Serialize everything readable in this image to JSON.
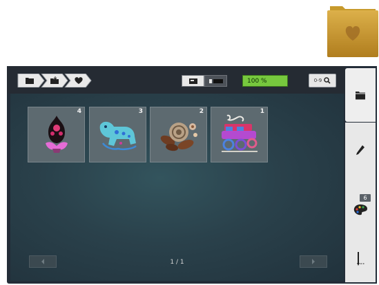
{
  "folder_preview": {
    "icon": "heart-folder-icon",
    "colors": {
      "folder": "#c89b2e",
      "heart": "#a8742a"
    }
  },
  "breadcrumb": [
    {
      "icon": "folder-icon"
    },
    {
      "icon": "open-folder-icon"
    },
    {
      "icon": "heart-icon"
    }
  ],
  "view_toggle": [
    {
      "icon": "embroidery-machine-icon",
      "active": true
    },
    {
      "icon": "list-view-icon",
      "active": false
    }
  ],
  "zoom_label": "100 %",
  "sort": {
    "label": "0-9",
    "icon": "magnifier-icon"
  },
  "designs": [
    {
      "number": "4",
      "motif": "paisley-flower"
    },
    {
      "number": "3",
      "motif": "blue-dog"
    },
    {
      "number": "2",
      "motif": "rose-leaves"
    },
    {
      "number": "1",
      "motif": "colorful-car"
    }
  ],
  "pagination": {
    "indicator": "1 / 1",
    "prev_icon": "arrow-left-icon",
    "next_icon": "arrow-right-icon"
  },
  "sidebar": [
    {
      "name": "folder",
      "icon": "folder-icon",
      "active": true
    },
    {
      "name": "edit",
      "icon": "pencil-icon"
    },
    {
      "name": "colors",
      "icon": "palette-icon",
      "badge": "6"
    },
    {
      "name": "stitch",
      "icon": "needle-icon"
    }
  ],
  "colors": {
    "accent_green": "#77c83e",
    "screen_bg": "#232d38",
    "content_bg": "#2a414b"
  }
}
